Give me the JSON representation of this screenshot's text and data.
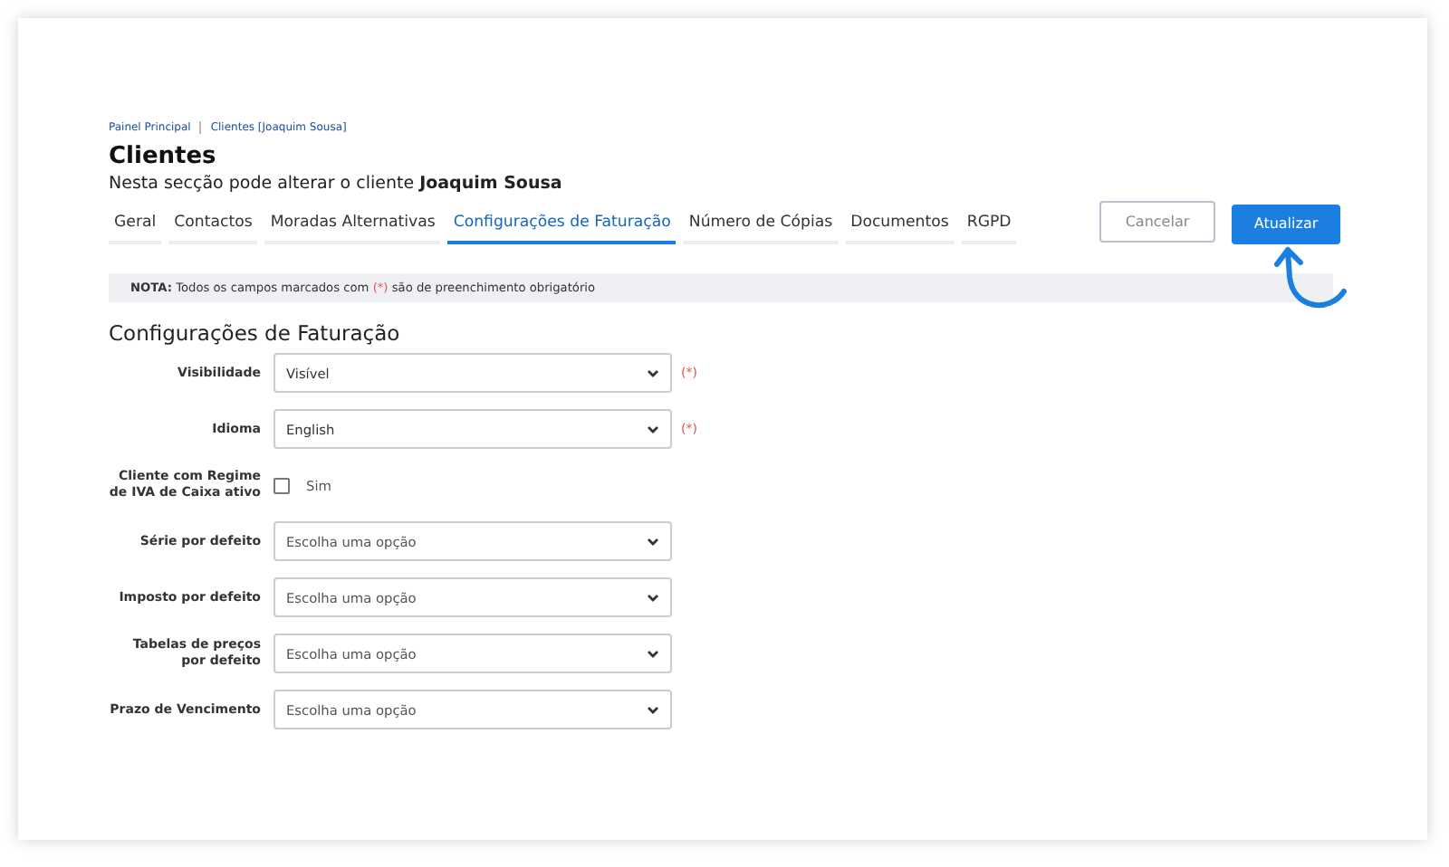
{
  "breadcrumb": [
    {
      "label": "Painel Principal"
    },
    {
      "label": "Clientes [Joaquim Sousa]"
    }
  ],
  "title": "Clientes",
  "subtitle": "Nesta secção pode alterar o cliente **Joaquim Sousa**",
  "tabs": [
    {
      "label": "Geral",
      "selected": false
    },
    {
      "label": "Contactos",
      "selected": false
    },
    {
      "label": "Moradas Alternativas",
      "selected": false
    },
    {
      "label": "Configurações de Faturação",
      "selected": true
    },
    {
      "label": "Número de Cópias",
      "selected": false
    },
    {
      "label": "Documentos",
      "selected": false
    },
    {
      "label": "RGPD",
      "selected": false
    }
  ],
  "buttons": {
    "cancel": "Cancelar",
    "submit": "Atualizar"
  },
  "note": {
    "label": "NOTA:",
    "before": "Todos os campos marcados com",
    "marker": "(*)",
    "after": "são de preenchimento obrigatório"
  },
  "section_title": "Configurações de Faturação",
  "fields": [
    {
      "kind": "select",
      "label": "Visibilidade",
      "value": "Visível",
      "required_mark": "(*)"
    },
    {
      "kind": "select",
      "label": "Idioma",
      "value": "English",
      "required_mark": "(*)"
    },
    {
      "kind": "checkbox",
      "label": "Cliente com Regime de IVA de Caixa ativo",
      "option": "Sim",
      "checked": false
    },
    {
      "kind": "select",
      "label": "Série por defeito",
      "placeholder": "Escolha uma opção"
    },
    {
      "kind": "select",
      "label": "Imposto por defeito",
      "placeholder": "Escolha uma opção"
    },
    {
      "kind": "select",
      "label": "Tabelas de preços por defeito",
      "placeholder": "Escolha uma opção"
    },
    {
      "kind": "select",
      "label": "Prazo de Vencimento",
      "placeholder": "Escolha uma opção"
    }
  ]
}
